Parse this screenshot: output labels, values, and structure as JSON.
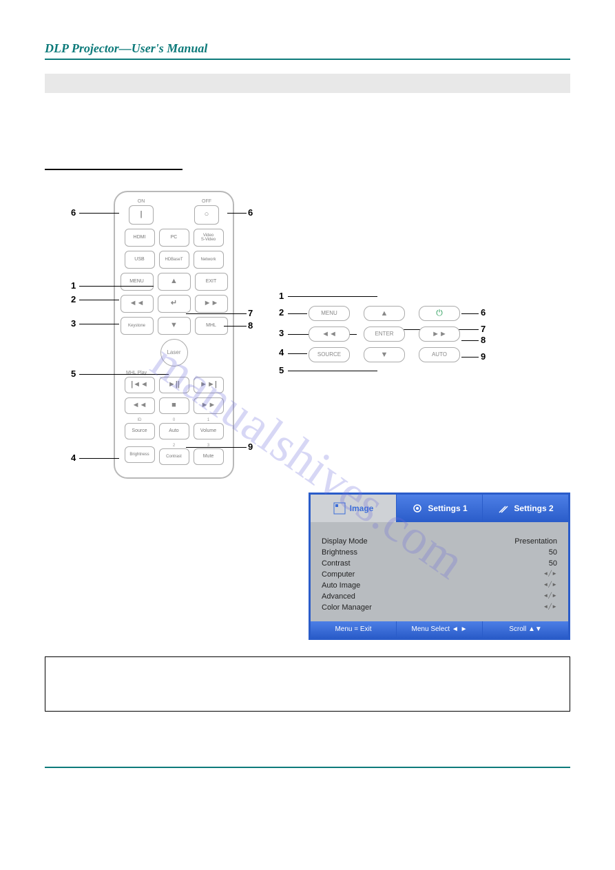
{
  "header": {
    "title": "DLP Projector—User's Manual"
  },
  "watermark": "manualshives.com",
  "remote": {
    "on": "ON",
    "off": "OFF",
    "row1": [
      "HDMI",
      "PC",
      "Video\nS-Video"
    ],
    "row2": [
      "USB",
      "HDBaseT",
      "Network"
    ],
    "row3": [
      "MENU",
      "▲",
      "EXIT"
    ],
    "row4": [
      "◄◄",
      "↵",
      "►►"
    ],
    "row5": [
      "Keystone",
      "▼",
      "MHL"
    ],
    "laser": "Laser",
    "mhlplay": "MHL Play",
    "row6": [
      "|◄◄",
      "►||",
      "►►|"
    ],
    "row7": [
      "◄◄",
      "■",
      "►►"
    ],
    "idrow_labels": [
      "ID",
      "0",
      "1"
    ],
    "row8": [
      "Source",
      "Auto",
      "Volume"
    ],
    "row9_labels": [
      "",
      "2",
      "3"
    ],
    "row9": [
      "Brightness",
      "Contrast",
      "Mute"
    ]
  },
  "callouts_left": [
    "6",
    "1",
    "2",
    "3",
    "5",
    "4"
  ],
  "callouts_right_remote": [
    "6",
    "7",
    "8",
    "9"
  ],
  "keypad": {
    "menu": "MENU",
    "up": "▲",
    "power": "⏻",
    "left": "◄◄",
    "enter": "ENTER",
    "right": "►►",
    "source": "SOURCE",
    "down": "▼",
    "auto": "AUTO"
  },
  "callouts_kp_left": [
    "1",
    "2",
    "3",
    "4",
    "5"
  ],
  "callouts_kp_right": [
    "6",
    "7",
    "8",
    "9"
  ],
  "osd": {
    "tabs": [
      "Image",
      "Settings 1",
      "Settings 2"
    ],
    "rows": [
      {
        "label": "Display Mode",
        "value": "Presentation"
      },
      {
        "label": "Brightness",
        "value": "50"
      },
      {
        "label": "Contrast",
        "value": "50"
      },
      {
        "label": "Computer",
        "value": "◄╱►"
      },
      {
        "label": "Auto Image",
        "value": "◄╱►"
      },
      {
        "label": "Advanced",
        "value": "◄╱►"
      },
      {
        "label": "Color Manager",
        "value": "◄╱►"
      }
    ],
    "footer": [
      "Menu = Exit",
      "Menu Select ◄ ►",
      "Scroll ▲▼"
    ]
  }
}
